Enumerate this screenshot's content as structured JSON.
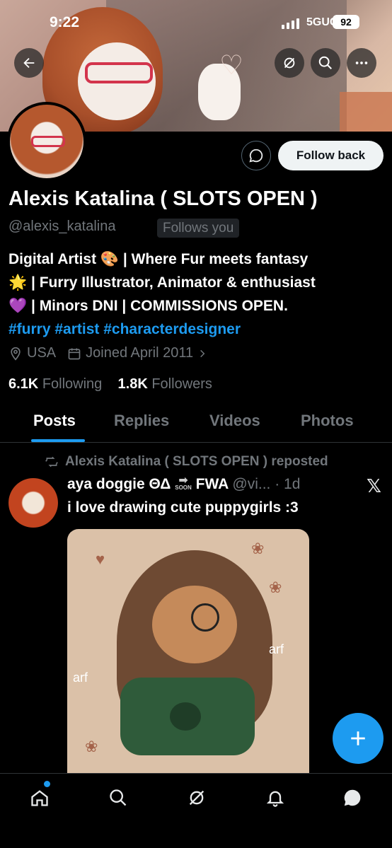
{
  "status_bar": {
    "time": "9:22",
    "network": "5GUC",
    "battery": "92"
  },
  "profile": {
    "name": "Alexis Katalina ( SLOTS OPEN )",
    "handle": "@alexis_katalina",
    "follows_you": "Follows you",
    "follow_button": "Follow back",
    "bio": {
      "line1": "Digital Artist 🎨 | Where Fur meets fantasy",
      "line2": "🌟 | Furry Illustrator, Animator & enthusiast",
      "line3": "💜 | Minors DNI | COMMISSIONS OPEN.",
      "hashtags": [
        "#furry",
        "#artist",
        "#characterdesigner"
      ]
    },
    "location": "USA",
    "joined": "Joined April 2011",
    "following_count": "6.1K",
    "following_label": "Following",
    "followers_count": "1.8K",
    "followers_label": "Followers"
  },
  "tabs": [
    {
      "label": "Posts",
      "active": true
    },
    {
      "label": "Replies",
      "active": false
    },
    {
      "label": "Videos",
      "active": false
    },
    {
      "label": "Photos",
      "active": false
    }
  ],
  "post": {
    "repost_label": "Alexis Katalina ( SLOTS OPEN ) reposted",
    "author_name": "aya doggie ΘΔ",
    "author_badge": "SOON",
    "author_suffix": "FWA",
    "author_handle": "@vi...",
    "time": "· 1d",
    "text": "i love drawing cute puppygirls :3",
    "image_labels": [
      "arf",
      "arf"
    ]
  },
  "colors": {
    "accent": "#1d9bf0",
    "muted": "#71767b",
    "background": "#000000"
  }
}
